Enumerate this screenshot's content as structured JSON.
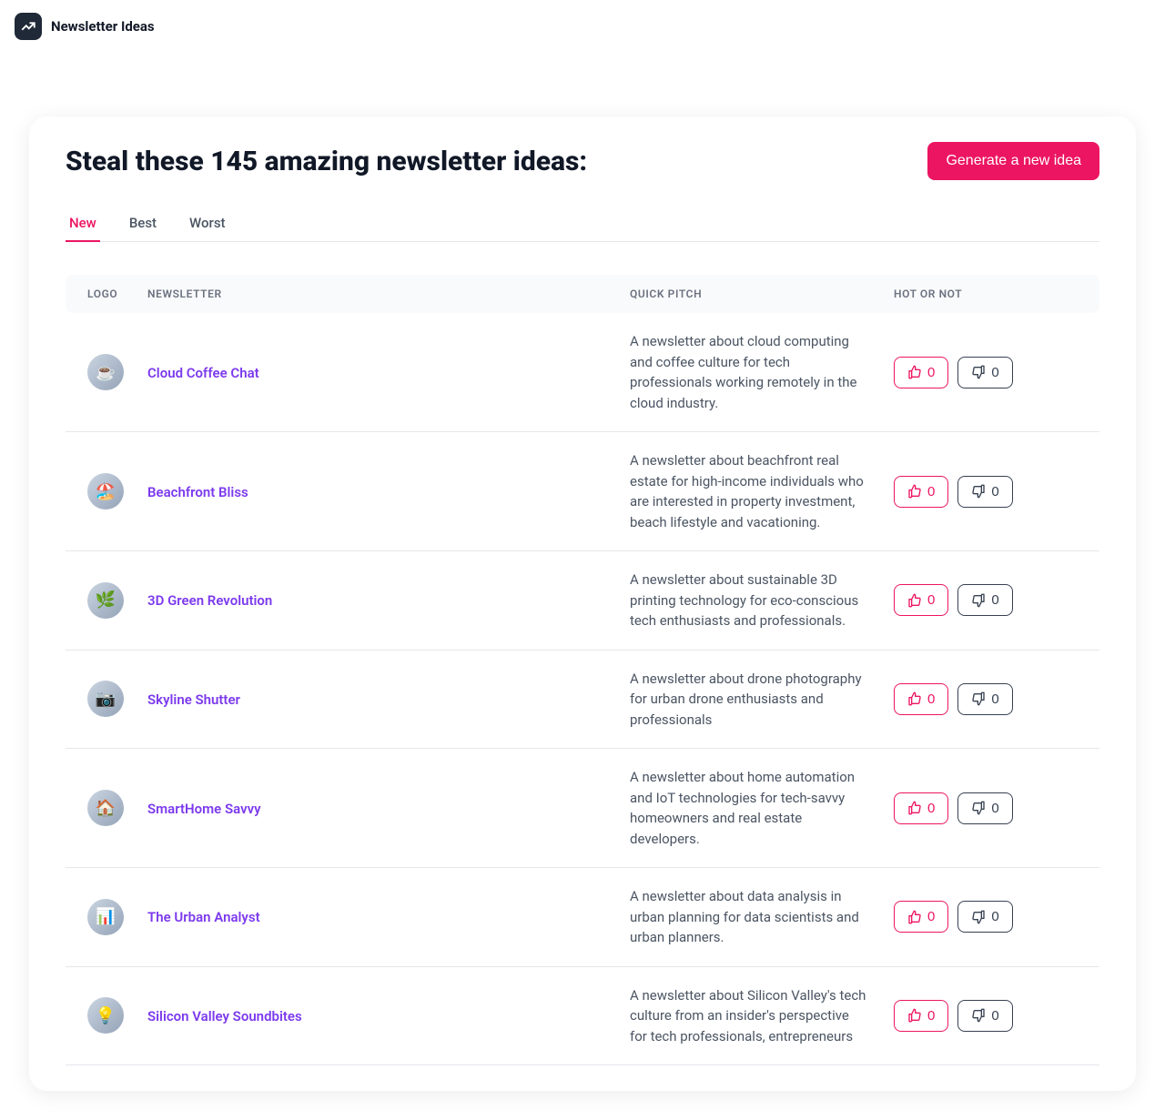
{
  "header": {
    "brand": "Newsletter Ideas"
  },
  "page": {
    "title": "Steal these 145 amazing newsletter ideas:",
    "generate_button": "Generate a new idea"
  },
  "tabs": [
    {
      "label": "New",
      "active": true
    },
    {
      "label": "Best",
      "active": false
    },
    {
      "label": "Worst",
      "active": false
    }
  ],
  "columns": {
    "logo": "LOGO",
    "newsletter": "NEWSLETTER",
    "pitch": "QUICK PITCH",
    "hot": "HOT OR NOT"
  },
  "rows": [
    {
      "name": "Cloud Coffee Chat",
      "pitch": "A newsletter about cloud computing and coffee culture for tech professionals working remotely in the cloud industry.",
      "up": "0",
      "down": "0",
      "emoji": "☕"
    },
    {
      "name": "Beachfront Bliss",
      "pitch": "A newsletter about beachfront real estate for high-income individuals who are interested in property investment, beach lifestyle and vacationing.",
      "up": "0",
      "down": "0",
      "emoji": "🏖️"
    },
    {
      "name": "3D Green Revolution",
      "pitch": "A newsletter about sustainable 3D printing technology for eco-conscious tech enthusiasts and professionals.",
      "up": "0",
      "down": "0",
      "emoji": "🌿"
    },
    {
      "name": "Skyline Shutter",
      "pitch": "A newsletter about drone photography for urban drone enthusiasts and professionals",
      "up": "0",
      "down": "0",
      "emoji": "📷"
    },
    {
      "name": "SmartHome Savvy",
      "pitch": "A newsletter about home automation and IoT technologies for tech-savvy homeowners and real estate developers.",
      "up": "0",
      "down": "0",
      "emoji": "🏠"
    },
    {
      "name": "The Urban Analyst",
      "pitch": "A newsletter about data analysis in urban planning for data scientists and urban planners.",
      "up": "0",
      "down": "0",
      "emoji": "📊"
    },
    {
      "name": "Silicon Valley Soundbites",
      "pitch": "A newsletter about Silicon Valley's tech culture from an insider's perspective for tech professionals, entrepreneurs",
      "up": "0",
      "down": "0",
      "emoji": "💡"
    }
  ]
}
